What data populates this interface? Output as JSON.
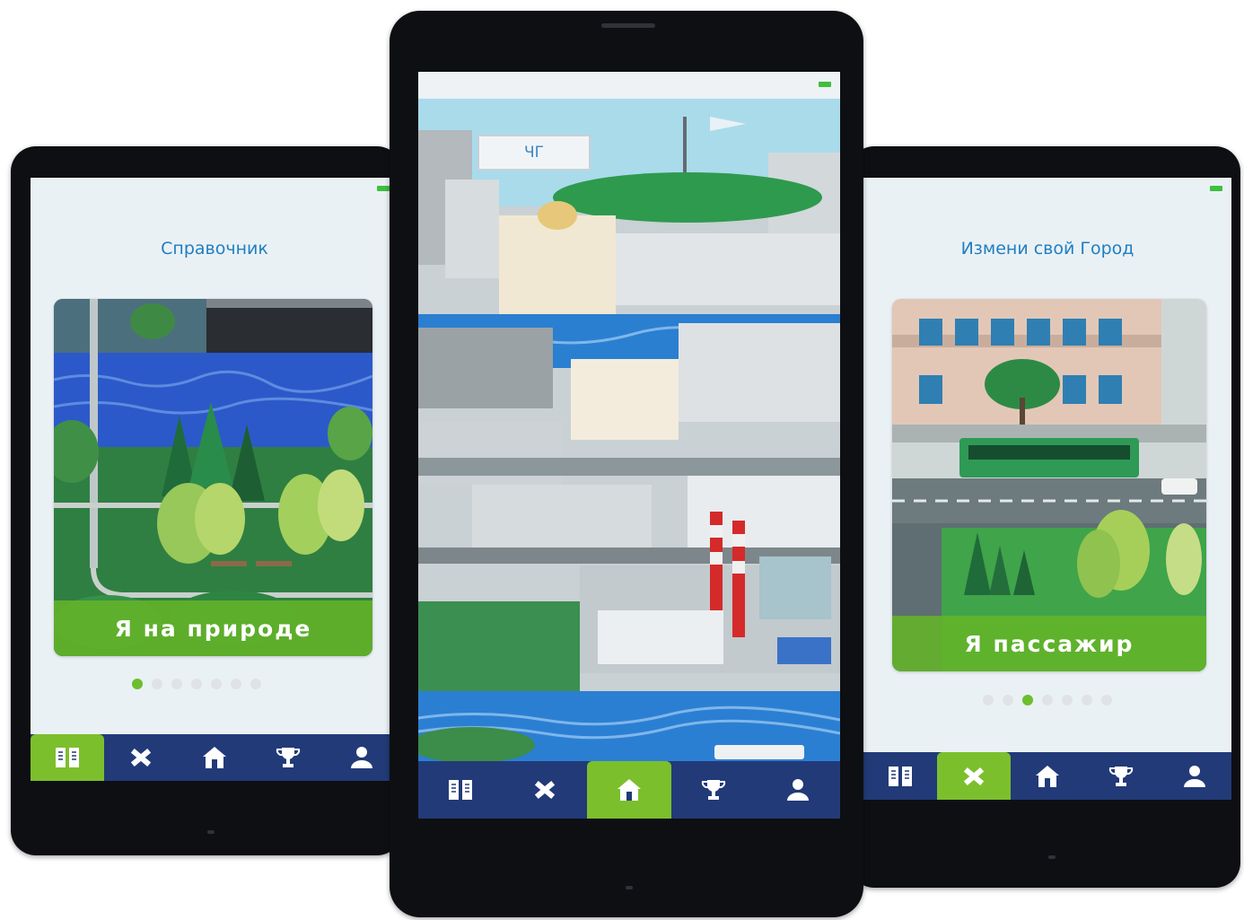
{
  "left_phone": {
    "screen_title": "Справочник",
    "card_label": "Я на природе",
    "pager": {
      "pages": 7,
      "active_index": 0
    },
    "nav": {
      "items": [
        "reference-book-icon",
        "pencil-ruler-icon",
        "home-icon",
        "trophy-icon",
        "profile-icon"
      ],
      "active_index": 0
    }
  },
  "center_phone": {
    "city_sign": "ЧГ",
    "nav": {
      "items": [
        "reference-book-icon",
        "pencil-ruler-icon",
        "home-icon",
        "trophy-icon",
        "profile-icon"
      ],
      "active_index": 2
    }
  },
  "right_phone": {
    "screen_title": "Измени свой Город",
    "card_label": "Я пассажир",
    "pager": {
      "pages": 7,
      "active_index": 2
    },
    "nav": {
      "items": [
        "reference-book-icon",
        "pencil-ruler-icon",
        "home-icon",
        "trophy-icon",
        "profile-icon"
      ],
      "active_index": 1
    }
  },
  "colors": {
    "title_blue": "#1f7fc0",
    "nav_bar": "#223a78",
    "accent_green": "#7cbf2c",
    "card_label_bg": "#64b428",
    "battery": "#3fbf3f"
  }
}
